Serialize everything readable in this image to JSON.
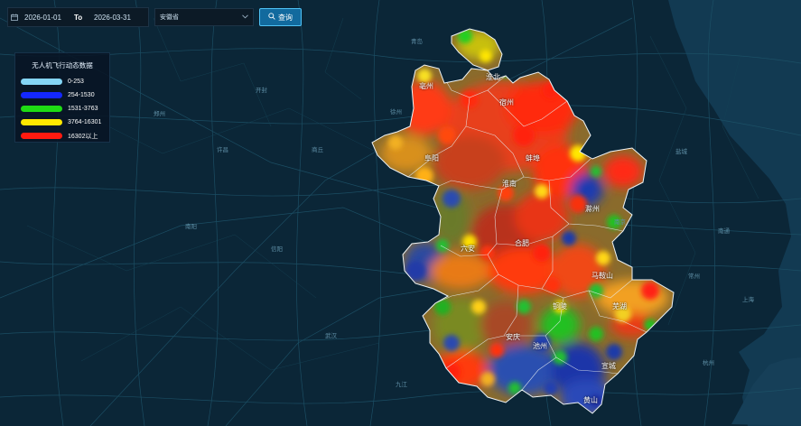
{
  "toolbar": {
    "start_date": "2026-01-01",
    "separator": "To",
    "end_date": "2026-03-31",
    "province_select": "安徽省",
    "query_label": "查询"
  },
  "legend": {
    "title": "无人机飞行动态数据",
    "items": [
      {
        "label": "0-253",
        "color": "#84d5f5"
      },
      {
        "label": "254-1530",
        "color": "#1428ff"
      },
      {
        "label": "1531-3763",
        "color": "#1fdc14"
      },
      {
        "label": "3764-16301",
        "color": "#ffe800"
      },
      {
        "label": "16302以上",
        "color": "#ff1a10"
      }
    ]
  },
  "cities": [
    "淮北",
    "亳州",
    "宿州",
    "蚌埠",
    "阜阳",
    "淮南",
    "滁州",
    "合肥",
    "六安",
    "马鞍山",
    "芜湖",
    "宣城",
    "铜陵",
    "池州",
    "安庆",
    "黄山"
  ],
  "places": [
    "青岛",
    "开封",
    "许昌",
    "武汉",
    "商丘",
    "徐州",
    "南京",
    "上海",
    "常州",
    "郑州",
    "杭州",
    "南通",
    "盐城",
    "南阳",
    "信阳",
    "九江"
  ]
}
